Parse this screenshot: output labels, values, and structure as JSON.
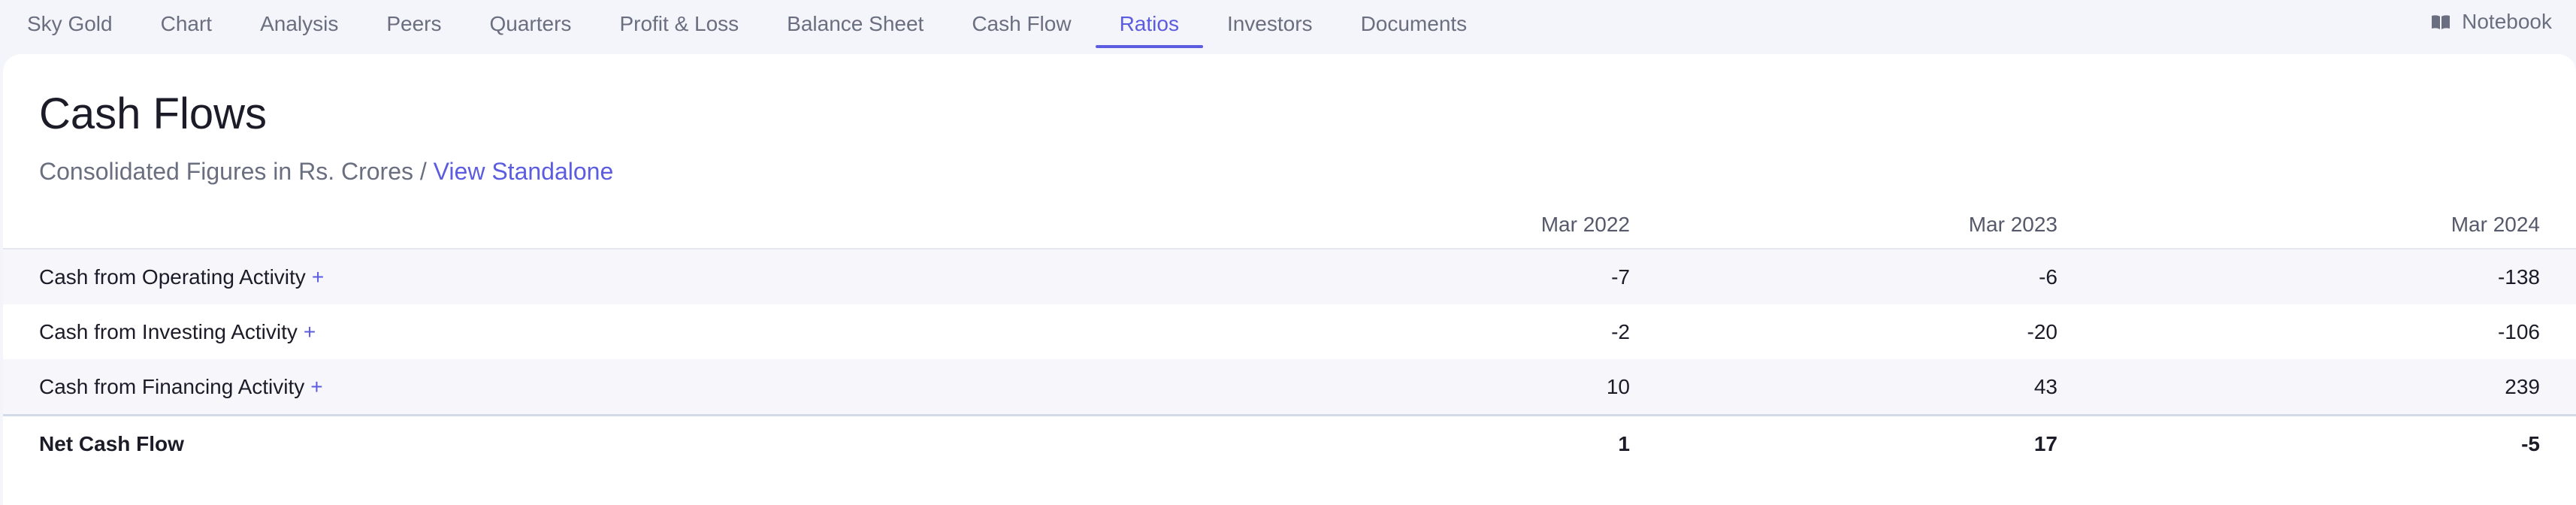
{
  "nav": {
    "tabs": [
      {
        "label": "Sky Gold"
      },
      {
        "label": "Chart"
      },
      {
        "label": "Analysis"
      },
      {
        "label": "Peers"
      },
      {
        "label": "Quarters"
      },
      {
        "label": "Profit & Loss"
      },
      {
        "label": "Balance Sheet"
      },
      {
        "label": "Cash Flow"
      },
      {
        "label": "Ratios",
        "active": true
      },
      {
        "label": "Investors"
      },
      {
        "label": "Documents"
      }
    ],
    "notebook_label": "Notebook",
    "notebook_icon": "book-icon"
  },
  "section": {
    "title": "Cash Flows",
    "subtitle_prefix": "Consolidated Figures in Rs. Crores / ",
    "subtitle_link": "View Standalone"
  },
  "table": {
    "columns": [
      "Mar 2022",
      "Mar 2023",
      "Mar 2024"
    ],
    "rows": [
      {
        "label": "Cash from Operating Activity",
        "expand": "+",
        "values": [
          "-7",
          "-6",
          "-138"
        ]
      },
      {
        "label": "Cash from Investing Activity",
        "expand": "+",
        "values": [
          "-2",
          "-20",
          "-106"
        ]
      },
      {
        "label": "Cash from Financing Activity",
        "expand": "+",
        "values": [
          "10",
          "43",
          "239"
        ]
      }
    ],
    "total": {
      "label": "Net Cash Flow",
      "values": [
        "1",
        "17",
        "-5"
      ]
    }
  },
  "colors": {
    "accent": "#5b5ce0",
    "text_muted": "#6a6f80",
    "background": "#f4f5fa"
  }
}
